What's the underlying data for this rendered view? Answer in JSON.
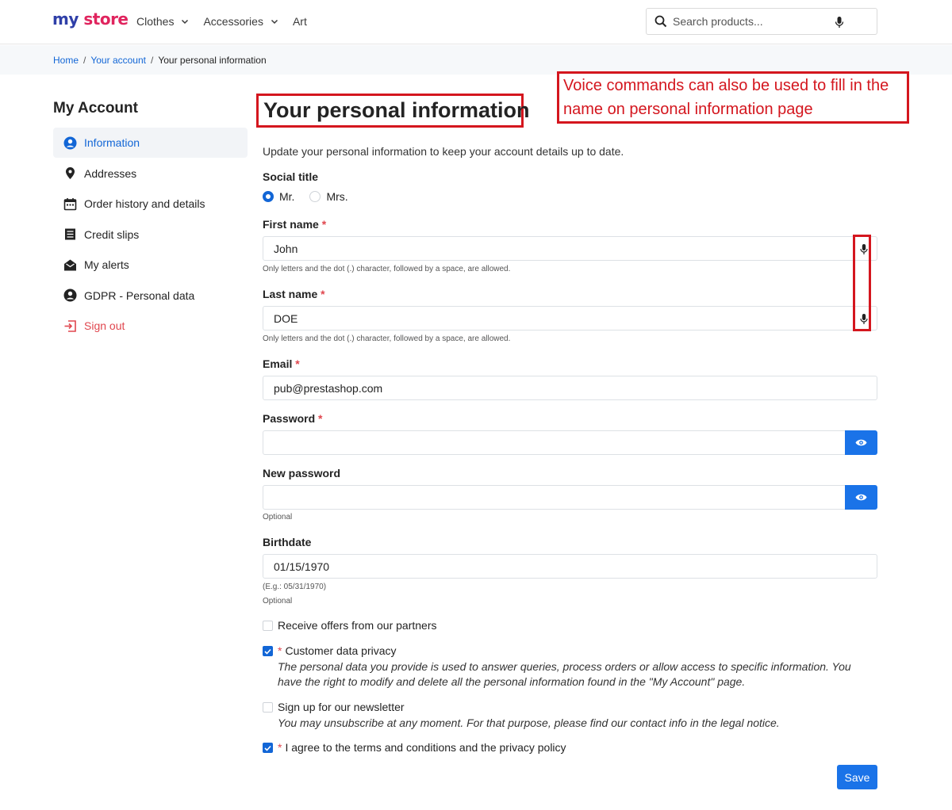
{
  "header": {
    "logo_part1": "my",
    "logo_part2": "store",
    "nav": [
      {
        "label": "Clothes",
        "has_dropdown": true
      },
      {
        "label": "Accessories",
        "has_dropdown": true
      },
      {
        "label": "Art",
        "has_dropdown": false
      }
    ],
    "search_placeholder": "Search products..."
  },
  "breadcrumb": {
    "home": "Home",
    "account": "Your account",
    "sep": "/",
    "current": "Your personal information"
  },
  "sidebar": {
    "title": "My Account",
    "items": [
      {
        "label": "Information",
        "icon": "user-circle-icon",
        "active": true
      },
      {
        "label": "Addresses",
        "icon": "map-pin-icon"
      },
      {
        "label": "Order history and details",
        "icon": "calendar-icon"
      },
      {
        "label": "Credit slips",
        "icon": "receipt-icon"
      },
      {
        "label": "My alerts",
        "icon": "mail-open-icon"
      },
      {
        "label": "GDPR - Personal data",
        "icon": "user-circle-icon"
      },
      {
        "label": "Sign out",
        "icon": "sign-out-icon"
      }
    ]
  },
  "annotation": {
    "title_highlight": "Your personal information",
    "note": "Voice commands can also be used to fill in the name on personal information page"
  },
  "form": {
    "intro": "Update your personal information to keep your account details up to date.",
    "social_title": {
      "label": "Social title",
      "options": [
        "Mr.",
        "Mrs."
      ],
      "selected": "Mr."
    },
    "first_name": {
      "label": "First name",
      "required": "*",
      "value": "John",
      "help": "Only letters and the dot (.) character, followed by a space, are allowed."
    },
    "last_name": {
      "label": "Last name",
      "required": "*",
      "value": "DOE",
      "help": "Only letters and the dot (.) character, followed by a space, are allowed."
    },
    "email": {
      "label": "Email",
      "required": "*",
      "value": "pub@prestashop.com"
    },
    "password": {
      "label": "Password",
      "required": "*",
      "value": ""
    },
    "new_password": {
      "label": "New password",
      "value": "",
      "help": "Optional"
    },
    "birthdate": {
      "label": "Birthdate",
      "value": "01/15/1970",
      "help1": "(E.g.: 05/31/1970)",
      "help2": "Optional"
    },
    "checks": {
      "offers": {
        "label": "Receive offers from our partners",
        "checked": false
      },
      "privacy": {
        "label": "Customer data privacy",
        "checked": true,
        "required": "*",
        "desc": "The personal data you provide is used to answer queries, process orders or allow access to specific information. You have the right to modify and delete all the personal information found in the \"My Account\" page."
      },
      "newsletter": {
        "label": "Sign up for our newsletter",
        "checked": false,
        "desc": "You may unsubscribe at any moment. For that purpose, please find our contact info in the legal notice."
      },
      "terms": {
        "label": "I agree to the terms and conditions and the privacy policy",
        "checked": true,
        "required": "*"
      }
    },
    "save_label": "Save"
  },
  "colors": {
    "primary": "#1a73e8",
    "link": "#1266d6",
    "annotation_red": "#d4161e",
    "danger": "#e0464e"
  }
}
